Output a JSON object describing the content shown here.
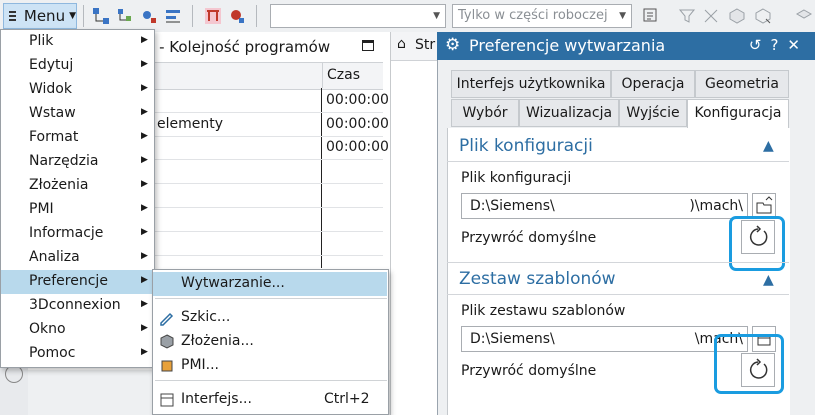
{
  "toolbar": {
    "menu_label": "Menu",
    "filter_combo_value": "",
    "scope_combo_placeholder": "Tylko w części roboczej"
  },
  "nav_panel": {
    "title": "ji - Kolejność programów",
    "col_time": "Czas",
    "rows": [
      {
        "time": "00:00:00"
      },
      {
        "time": "00:00:00"
      },
      {
        "time": "00:00:00"
      }
    ],
    "row_text": "elementy",
    "str_tab": "Str"
  },
  "main_menu": {
    "items": [
      {
        "label": "Plik",
        "has_sub": true
      },
      {
        "label": "Edytuj",
        "has_sub": true
      },
      {
        "label": "Widok",
        "has_sub": true
      },
      {
        "label": "Wstaw",
        "has_sub": true
      },
      {
        "label": "Format",
        "has_sub": true
      },
      {
        "label": "Narzędzia",
        "has_sub": true
      },
      {
        "label": "Złożenia",
        "has_sub": true
      },
      {
        "label": "PMI",
        "has_sub": true
      },
      {
        "label": "Informacje",
        "has_sub": true
      },
      {
        "label": "Analiza",
        "has_sub": true
      },
      {
        "label": "Preferencje",
        "has_sub": true,
        "selected": true
      },
      {
        "label": "3Dconnexion",
        "has_sub": true
      },
      {
        "label": "Okno",
        "has_sub": true
      },
      {
        "label": "Pomoc",
        "has_sub": true
      }
    ]
  },
  "submenu": {
    "items": [
      {
        "label": "Wytwarzanie...",
        "shortcut": "",
        "icon": "manufacturing-icon",
        "selected": true
      },
      {
        "label": "Szkic...",
        "shortcut": "",
        "icon": "sketch-icon"
      },
      {
        "label": "Złożenia...",
        "shortcut": "",
        "icon": "assemblies-icon"
      },
      {
        "label": "PMI...",
        "shortcut": "",
        "icon": "pmi-icon"
      },
      {
        "label": "Interfejs...",
        "shortcut": "Ctrl+2",
        "icon": "interface-icon"
      }
    ]
  },
  "pref_panel": {
    "title": "Preferencje wytwarzania",
    "tabs_row1": [
      "Interfejs użytkownika",
      "Operacja",
      "Geometria"
    ],
    "tabs_row2": [
      "Wybór",
      "Wizualizacja",
      "Wyjście",
      "Konfiguracja"
    ],
    "active_tab": "Konfiguracja",
    "sections": [
      {
        "title": "Plik konfiguracji",
        "field_label": "Plik konfiguracji",
        "value_left": "D:\\Siemens\\",
        "value_right": ")\\mach\\",
        "reset_label": "Przywróć domyślne"
      },
      {
        "title": "Zestaw szablonów",
        "field_label": "Plik zestawu szablonów",
        "value_left": "D:\\Siemens\\",
        "value_right": "\\mach\\",
        "reset_label": "Przywróć domyślne"
      }
    ]
  },
  "colors": {
    "accent": "#2d6ea3",
    "highlight": "#1a9ce0",
    "menu_selected": "#b8d9ec"
  }
}
